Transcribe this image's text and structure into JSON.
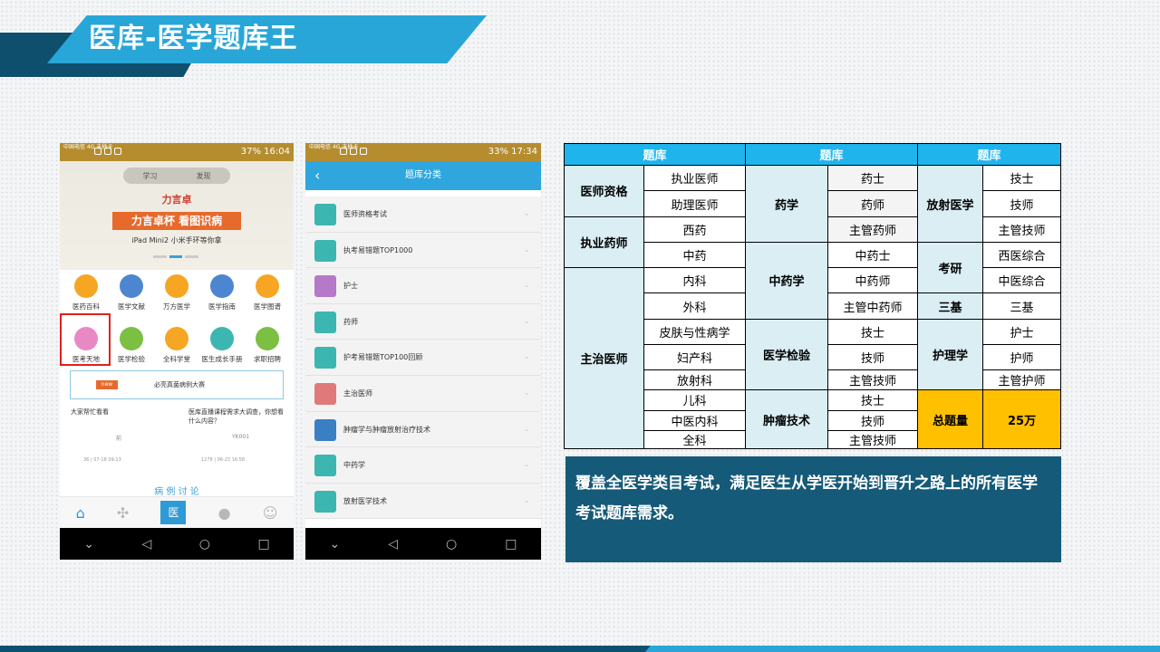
{
  "header": {
    "title": "医库-医学题库王"
  },
  "phone1": {
    "status_left": "中国电信 4G\n未插卡",
    "status_right": "37%  16:04",
    "tabs": [
      "学习",
      "发现"
    ],
    "brand": "力言卓",
    "slogan": "力言卓杯 看图识病",
    "sub": "iPad Mini2 小米手环等你拿",
    "grid": [
      {
        "label": "医药百科",
        "color": "#f6a623"
      },
      {
        "label": "医学文献",
        "color": "#4c86d0"
      },
      {
        "label": "万方医学",
        "color": "#f6a623"
      },
      {
        "label": "医学指南",
        "color": "#4c86d0"
      },
      {
        "label": "医学图谱",
        "color": "#f6a623"
      },
      {
        "label": "医考天地",
        "color": "#e889c6"
      },
      {
        "label": "医学检验",
        "color": "#7bbf43"
      },
      {
        "label": "全科学堂",
        "color": "#f6a623"
      },
      {
        "label": "医生成长手册",
        "color": "#3cb6b0"
      },
      {
        "label": "求职招聘",
        "color": "#7bbf43"
      }
    ],
    "news_tag": "new",
    "news_text": "必亮真菌病例大赛",
    "post1_title": "大家帮忙看看",
    "post1_author": "前",
    "post1_meta": "36  |  07-18 09:13",
    "post2_title": "医库直播课程需求大调查，你想看什么内容？",
    "post2_author": "YK001",
    "post2_meta": "1278  |  06-23 16:58",
    "case_title": "病 例 讨 论",
    "bottom_med": "医"
  },
  "phone2": {
    "status_left": "中国电信 4G\n未插卡",
    "status_right": "33%  17:34",
    "title": "题库分类",
    "items": [
      {
        "label": "医师资格考试",
        "color": "#3cb6b0"
      },
      {
        "label": "执考易错题TOP1000",
        "color": "#3cb6b0"
      },
      {
        "label": "护士",
        "color": "#b678c8"
      },
      {
        "label": "药师",
        "color": "#3cb6b0"
      },
      {
        "label": "护考易错题TOP100回顾",
        "color": "#3cb6b0"
      },
      {
        "label": "主治医师",
        "color": "#e07a7a"
      },
      {
        "label": "肿瘤学与肿瘤放射治疗技术",
        "color": "#3a7fc4"
      },
      {
        "label": "中药学",
        "color": "#3cb6b0"
      },
      {
        "label": "放射医学技术",
        "color": "#3cb6b0"
      }
    ]
  },
  "table": {
    "header": [
      "题库",
      "题库",
      "题库"
    ],
    "col1": {
      "cats": [
        "医师资格",
        "执业药师",
        "主治医师"
      ],
      "items": [
        "执业医师",
        "助理医师",
        "西药",
        "中药",
        "内科",
        "外科",
        "皮肤与性病学",
        "妇产科",
        "放射科",
        "儿科",
        "中医内科",
        "全科"
      ]
    },
    "col2": {
      "cats": [
        "药学",
        "中药学",
        "医学检验",
        "肿瘤技术"
      ],
      "items": [
        "药士",
        "药师",
        "主管药师",
        "中药士",
        "中药师",
        "主管中药师",
        "技士",
        "技师",
        "主管技师",
        "技士",
        "技师",
        "主管技师"
      ]
    },
    "col3": {
      "cats": [
        "放射医学",
        "考研",
        "三基",
        "护理学"
      ],
      "items": [
        "技士",
        "技师",
        "主管技师",
        "西医综合",
        "中医综合",
        "三基",
        "护士",
        "护师",
        "主管护师"
      ],
      "total_label": "总题量",
      "total_value": "25万"
    }
  },
  "description": "覆盖全医学类目考试，满足医生从学医开始到晋升之路上的所有医学考试题库需求。"
}
